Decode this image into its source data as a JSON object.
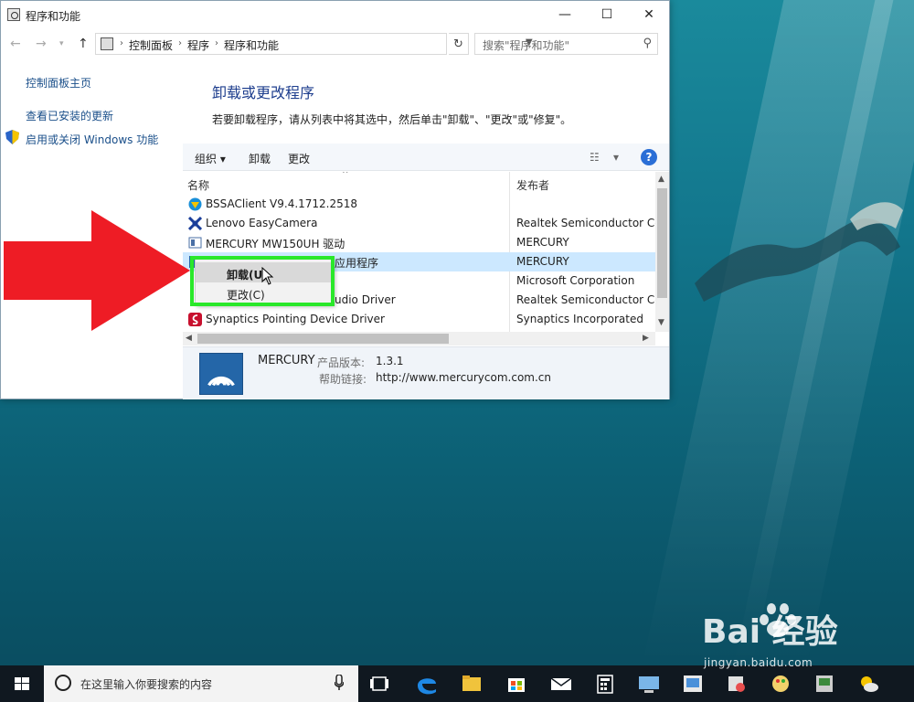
{
  "window": {
    "title": "程序和功能",
    "controls": {
      "minimize": "—",
      "maximize": "☐",
      "close": "✕"
    }
  },
  "nav": {
    "breadcrumbs": [
      "控制面板",
      "程序",
      "程序和功能"
    ],
    "search_placeholder": "搜索\"程序和功能\""
  },
  "left_pane": {
    "links": [
      "控制面板主页",
      "查看已安装的更新",
      "启用或关闭 Windows 功能"
    ]
  },
  "main": {
    "heading": "卸载或更改程序",
    "hint": "若要卸载程序，请从列表中将其选中，然后单击\"卸载\"、\"更改\"或\"修复\"。"
  },
  "toolbar": {
    "organize": "组织 ▾",
    "uninstall": "卸载",
    "change": "更改"
  },
  "list": {
    "columns": [
      "名称",
      "发布者"
    ],
    "rows": [
      {
        "name": "BSSAClient V9.4.1712.2518",
        "publisher": "",
        "icon": "bssa-icon"
      },
      {
        "name": "Lenovo EasyCamera",
        "publisher": "Realtek Semiconductor Co",
        "icon": "camera-icon"
      },
      {
        "name": "MERCURY MW150UH 驱动",
        "publisher": "MERCURY",
        "icon": "driver-icon"
      },
      {
        "name": "应用程序",
        "publisher": "MERCURY",
        "icon": "app-icon",
        "selected": true
      },
      {
        "name": "",
        "publisher": "Microsoft Corporation",
        "icon": ""
      },
      {
        "name": "udio Driver",
        "publisher": "Realtek Semiconductor Co",
        "icon": ""
      },
      {
        "name": "Synaptics Pointing Device Driver",
        "publisher": "Synaptics Incorporated",
        "icon": "synaptics-icon"
      }
    ]
  },
  "details": {
    "publisher": "MERCURY",
    "version_label": "产品版本:",
    "version": "1.3.1",
    "help_label": "帮助链接:",
    "help_url": "http://www.mercurycom.com.cn"
  },
  "context_menu": {
    "items": [
      "卸载(U)",
      "更改(C)"
    ]
  },
  "taskbar": {
    "search_placeholder": "在这里输入你要搜索的内容"
  },
  "watermark": {
    "brand": "Bai 经验",
    "url": "jingyan.baidu.com"
  },
  "colors": {
    "accent": "#1e3e8e",
    "selection": "#cce8ff",
    "highlight_box": "#2ae82a",
    "arrow": "#ee1c25"
  }
}
